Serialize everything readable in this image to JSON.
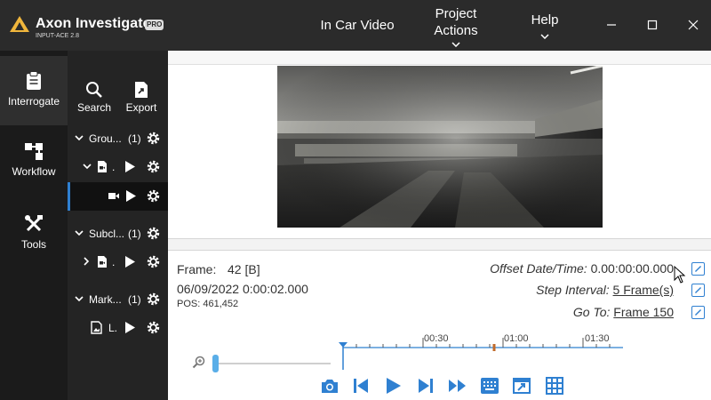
{
  "app": {
    "title": "Axon Investigate",
    "badge": "PRO",
    "subtitle": "INPUT-ACE 2.8"
  },
  "menu": {
    "in_car_video": "In Car Video",
    "project_actions_line1": "Project",
    "project_actions_line2": "Actions",
    "help": "Help"
  },
  "nav": {
    "interrogate": "Interrogate",
    "workflow": "Workflow",
    "tools": "Tools"
  },
  "toolbar": {
    "search": "Search",
    "export": "Export"
  },
  "tree": {
    "group_label": "Grou...",
    "group_count": "(1)",
    "file_label": ".",
    "subclip_label": "Subcl...",
    "subclip_count": "(1)",
    "marker_label": "Mark...",
    "marker_count": "(1)",
    "image_label": "L."
  },
  "info": {
    "frame_label": "Frame:",
    "frame_value": "42 [B]",
    "date": "06/09/2022 0:00:02.000",
    "pos": "POS: 461,452",
    "offset_label": "Offset Date/Time:",
    "offset_value": "0.00:00:00.000",
    "step_label": "Step Interval:",
    "step_value": "5 Frame(s)",
    "goto_label": "Go To:",
    "goto_value": "Frame 150"
  },
  "timeline": {
    "ticks": [
      "00:30",
      "01:00",
      "01:30"
    ],
    "accent": "#2f80d1",
    "marker_color": "#c06a2a"
  },
  "colors": {
    "titlebar": "#2b2b2b",
    "nav": "#1b1b1b",
    "panel": "#242424",
    "accent": "#2f80d1"
  }
}
